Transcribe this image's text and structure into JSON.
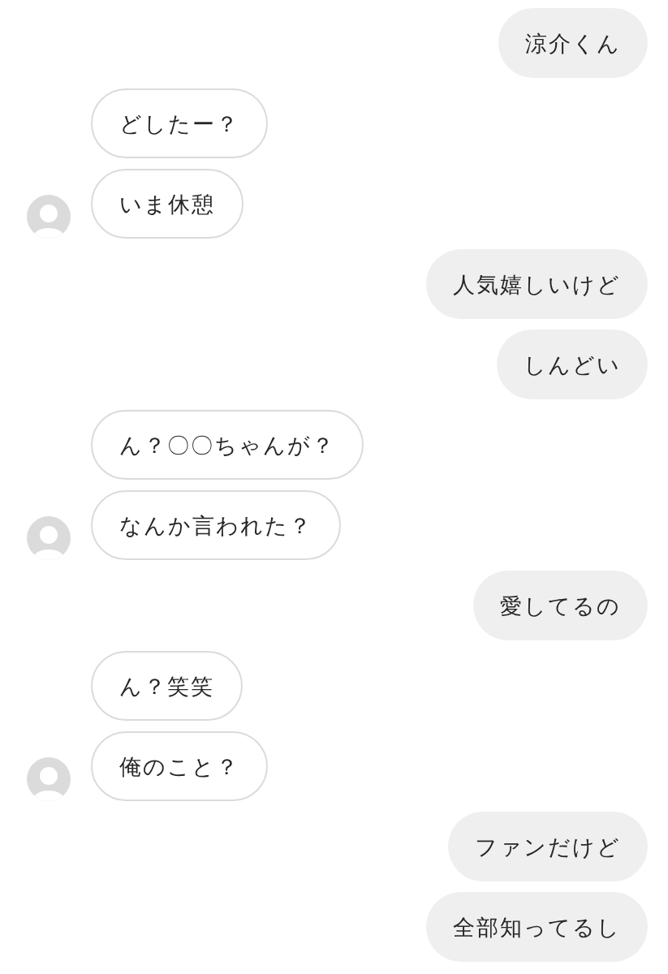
{
  "conversation": [
    {
      "kind": "sent",
      "bubbles": [
        "涼介くん"
      ]
    },
    {
      "kind": "received",
      "bubbles": [
        "どしたー？",
        "いま休憩"
      ]
    },
    {
      "kind": "sent",
      "bubbles": [
        "人気嬉しいけど",
        "しんどい"
      ]
    },
    {
      "kind": "received",
      "bubbles": [
        "ん？〇〇ちゃんが？",
        "なんか言われた？"
      ]
    },
    {
      "kind": "sent",
      "bubbles": [
        "愛してるの"
      ]
    },
    {
      "kind": "received",
      "bubbles": [
        "ん？笑笑",
        "俺のこと？"
      ]
    },
    {
      "kind": "sent",
      "bubbles": [
        "ファンだけど",
        "全部知ってるし"
      ]
    }
  ]
}
